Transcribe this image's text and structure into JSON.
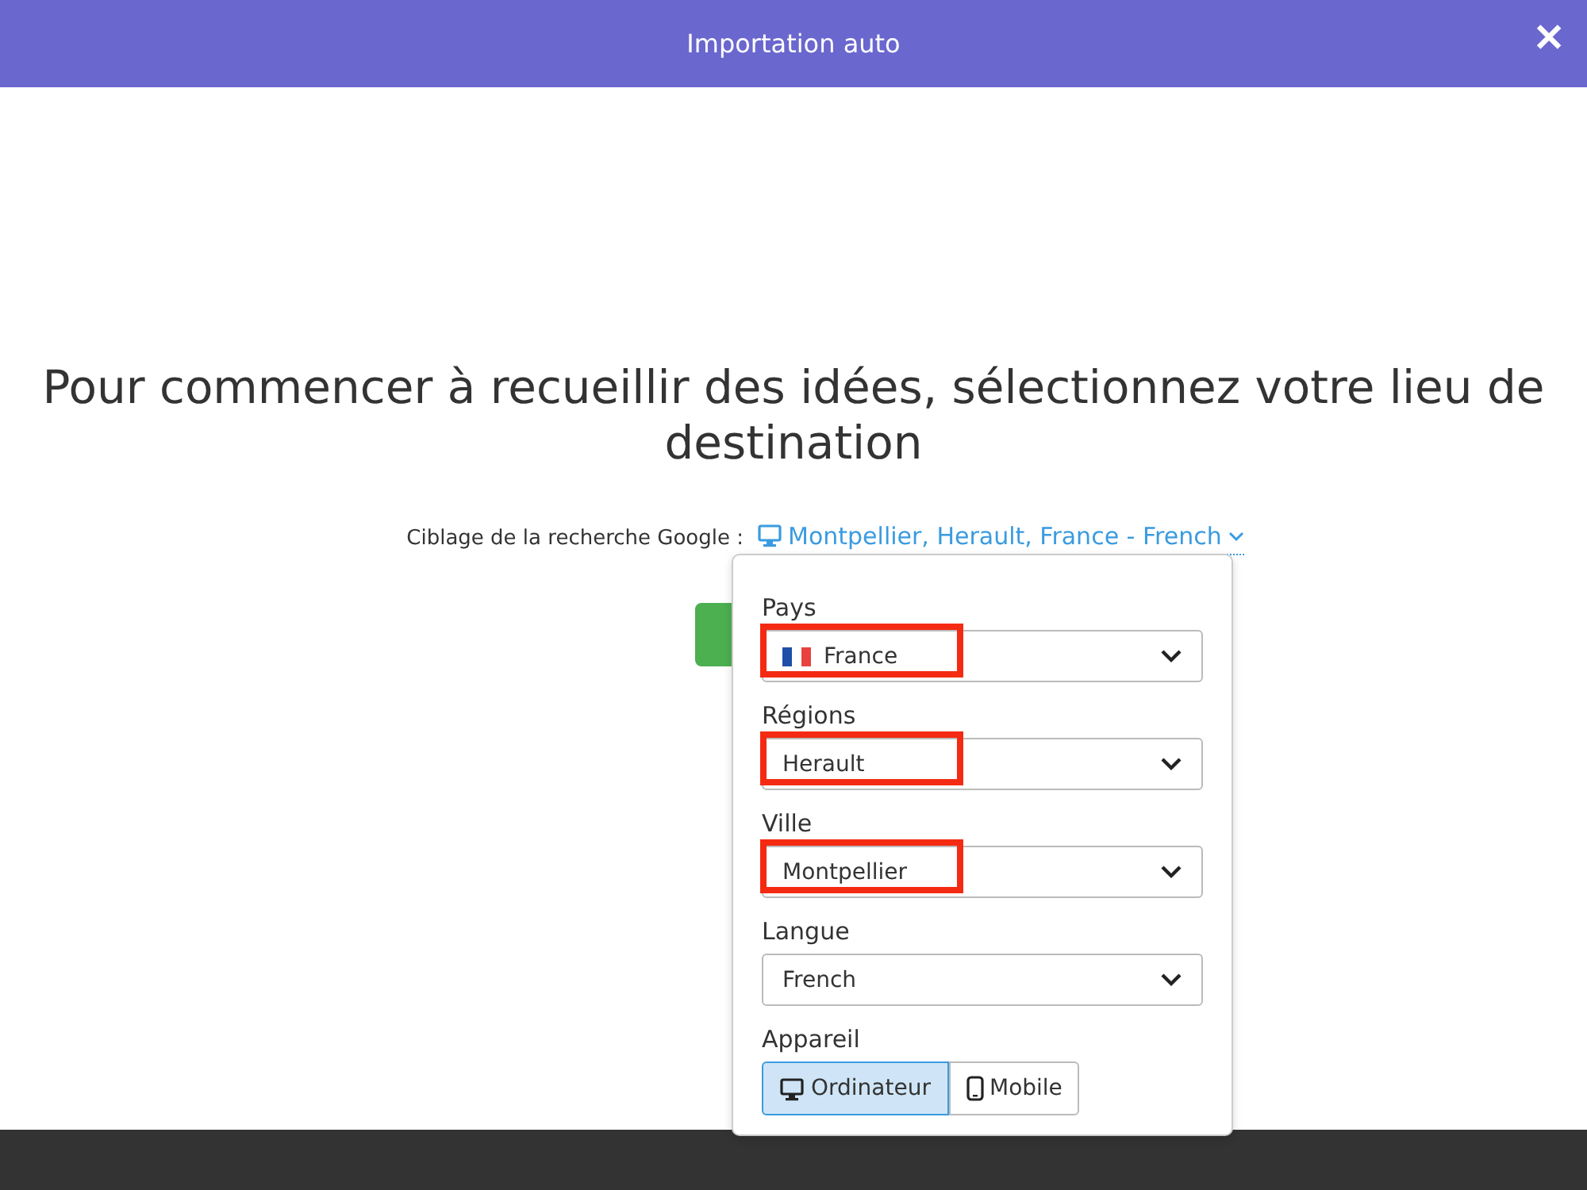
{
  "header": {
    "title": "Importation auto",
    "close": "✕"
  },
  "heading": "Pour commencer à recueillir des idées, sélectionnez votre lieu de destination",
  "targeting": {
    "label": "Ciblage de la recherche Google :",
    "value": "Montpellier, Herault, France - French"
  },
  "popover": {
    "fields": [
      {
        "label": "Pays",
        "value": "France",
        "kind": "flag",
        "highlighted": true
      },
      {
        "label": "Régions",
        "value": "Herault",
        "kind": "plain",
        "highlighted": true
      },
      {
        "label": "Ville",
        "value": "Montpellier",
        "kind": "plain",
        "highlighted": true
      },
      {
        "label": "Langue",
        "value": "French",
        "kind": "plain",
        "highlighted": false
      }
    ],
    "device": {
      "label": "Appareil",
      "options": [
        {
          "label": "Ordinateur",
          "kind": "desktop",
          "selected": true
        },
        {
          "label": "Mobile",
          "kind": "mobile",
          "selected": false
        }
      ]
    }
  }
}
